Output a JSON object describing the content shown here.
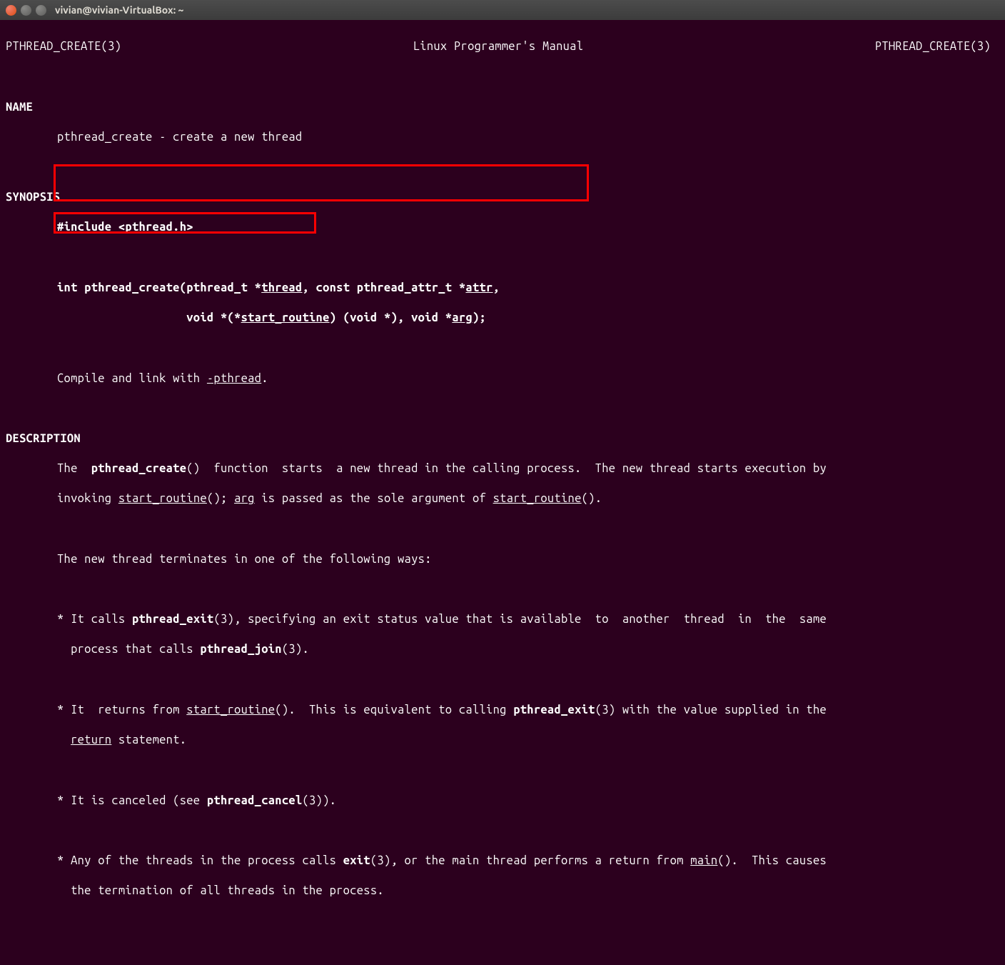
{
  "window": {
    "title": "vivian@vivian-VirtualBox: ~"
  },
  "man": {
    "header_left": "PTHREAD_CREATE(3)",
    "header_center": "Linux Programmer's Manual",
    "header_right": "PTHREAD_CREATE(3)",
    "section_name": "NAME",
    "name_line": "pthread_create - create a new thread",
    "section_synopsis": "SYNOPSIS",
    "include_line": "#include <pthread.h>",
    "proto1_a": "int pthread_create(pthread_t *",
    "proto1_thread": "thread",
    "proto1_b": ", const pthread_attr_t *",
    "proto1_attr": "attr",
    "proto1_c": ",",
    "proto2_a": "                   void *(*",
    "proto2_sr": "start_routine",
    "proto2_b": ") (void *), void *",
    "proto2_arg": "arg",
    "proto2_c": ");",
    "compile_a": "Compile and link with ",
    "compile_flag": "-pthread",
    "compile_b": ".",
    "section_desc": "DESCRIPTION",
    "desc1_a": "The  ",
    "desc1_b": "pthread_create",
    "desc1_c": "()  function  starts  a new thread in the calling process.  The new thread starts execution by",
    "desc2_a": "invoking ",
    "desc2_sr": "start_routine",
    "desc2_b": "(); ",
    "desc2_arg": "arg",
    "desc2_c": " is passed as the sole argument of ",
    "desc2_sr2": "start_routine",
    "desc2_d": "().",
    "term_intro": "The new thread terminates in one of the following ways:",
    "b1_a": "* It calls ",
    "b1_b": "pthread_exit",
    "b1_c": "(3), specifying an exit status value that is available  to  another  thread  in  the  same",
    "b1_d": "  process that calls ",
    "b1_e": "pthread_join",
    "b1_f": "(3).",
    "b2_a": "* It  returns from ",
    "b2_sr": "start_routine",
    "b2_b": "().  This is equivalent to calling ",
    "b2_c": "pthread_exit",
    "b2_d": "(3) with the value supplied in the",
    "b2_e": "  ",
    "b2_ret": "return",
    "b2_f": " statement.",
    "b3_a": "* It is canceled (see ",
    "b3_b": "pthread_cancel",
    "b3_c": "(3)).",
    "b4_a": "* Any of the threads in the process calls ",
    "b4_b": "exit",
    "b4_c": "(3), or the main thread performs a return from ",
    "b4_main": "main",
    "b4_d": "().  This causes",
    "b4_e": "  the termination of all threads in the process."
  }
}
